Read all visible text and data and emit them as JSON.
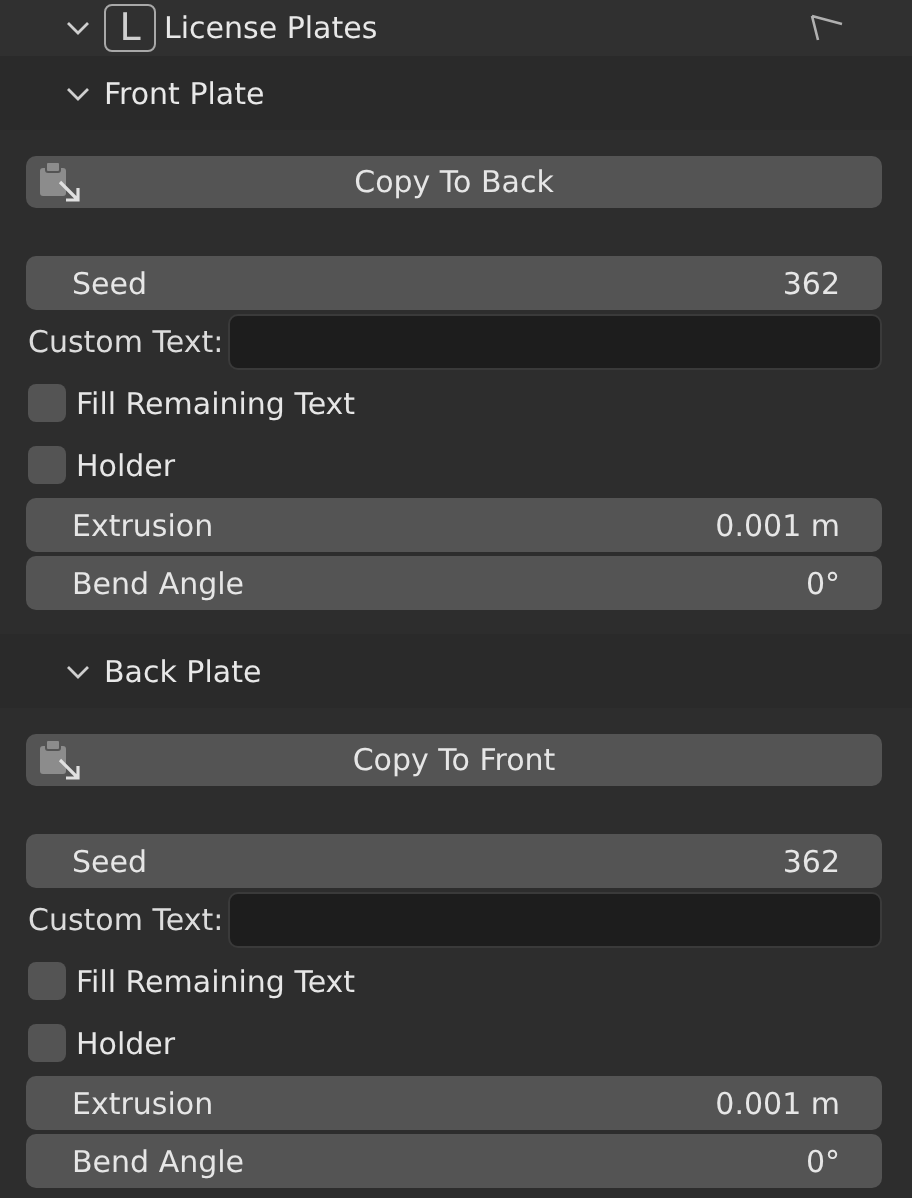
{
  "panel": {
    "title": "License Plates",
    "icon_letter": "L",
    "expanded": true
  },
  "sections": [
    {
      "title": "Front Plate",
      "expanded": true,
      "rows": [
        {
          "kind": "button",
          "label": "Copy To Back"
        },
        {
          "kind": "number",
          "label": "Seed",
          "value": "362"
        },
        {
          "kind": "text",
          "label": "Custom Text:"
        },
        {
          "kind": "checkbox",
          "label": "Fill Remaining Text",
          "checked": false
        },
        {
          "kind": "checkbox",
          "label": "Holder",
          "checked": false
        },
        {
          "kind": "number",
          "label": "Extrusion",
          "value": "0.001 m"
        },
        {
          "kind": "number",
          "label": "Bend Angle",
          "value": "0°"
        }
      ]
    },
    {
      "title": "Back Plate",
      "expanded": true,
      "rows": [
        {
          "kind": "button",
          "label": "Copy To Front"
        },
        {
          "kind": "number",
          "label": "Seed",
          "value": "362"
        },
        {
          "kind": "text",
          "label": "Custom Text:"
        },
        {
          "kind": "checkbox",
          "label": "Fill Remaining Text",
          "checked": false
        },
        {
          "kind": "checkbox",
          "label": "Holder",
          "checked": false
        },
        {
          "kind": "number",
          "label": "Extrusion",
          "value": "0.001 m"
        },
        {
          "kind": "number",
          "label": "Bend Angle",
          "value": "0°"
        }
      ]
    }
  ]
}
